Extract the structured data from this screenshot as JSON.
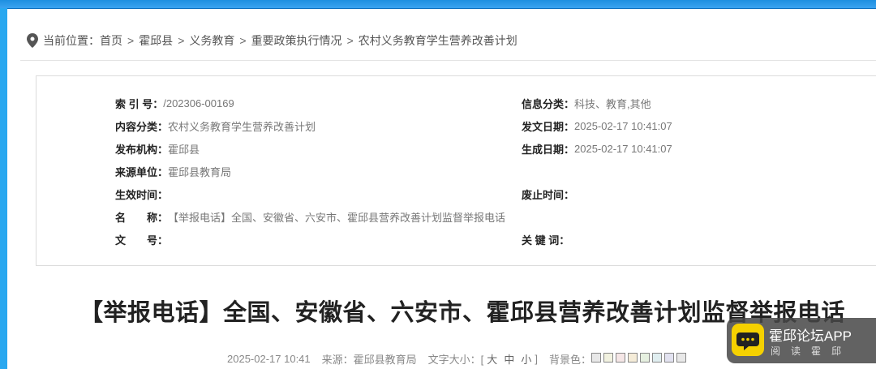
{
  "breadcrumb": {
    "prefix": "当前位置：",
    "items": [
      "首页",
      "霍邱县",
      "义务教育",
      "重要政策执行情况",
      "农村义务教育学生营养改善计划"
    ],
    "separator": ">"
  },
  "info": {
    "index_no": {
      "label": "索 引 号：",
      "value": "/202306-00169"
    },
    "info_category": {
      "label": "信息分类：",
      "value": "科技、教育,其他"
    },
    "content_category": {
      "label": "内容分类：",
      "value": "农村义务教育学生营养改善计划"
    },
    "issue_date": {
      "label": "发文日期：",
      "value": "2025-02-17 10:41:07"
    },
    "publisher": {
      "label": "发布机构：",
      "value": "霍邱县"
    },
    "generated_date": {
      "label": "生成日期：",
      "value": "2025-02-17 10:41:07"
    },
    "source_unit": {
      "label": "来源单位：",
      "value": "霍邱县教育局"
    },
    "effective_time": {
      "label": "生效时间：",
      "value": ""
    },
    "expiry_time": {
      "label": "废止时间：",
      "value": ""
    },
    "name": {
      "label": "名　　称：",
      "value": "【举报电话】全国、安徽省、六安市、霍邱县营养改善计划监督举报电话"
    },
    "doc_no": {
      "label": "文　　号：",
      "value": ""
    },
    "keywords": {
      "label": "关 键 词：",
      "value": ""
    }
  },
  "article": {
    "title": "【举报电话】全国、安徽省、六安市、霍邱县营养改善计划监督举报电话",
    "date": "2025-02-17 10:41",
    "source": "来源：霍邱县教育局",
    "font_size_label": "文字大小：[",
    "font_sizes": [
      "大",
      "中",
      "小"
    ],
    "font_size_close": "]",
    "bg_label": "背景色：",
    "bg_colors": [
      "#e8e8e8",
      "#f2f2e0",
      "#f5e6e6",
      "#f5ecd8",
      "#e6f0e0",
      "#e0eef0",
      "#e2e2f0",
      "#e8e8e8"
    ]
  },
  "app_badge": {
    "name": "霍邱论坛APP",
    "tagline": "阅读霍邱",
    "icon": "chat-bubble-icon",
    "accent": "#f5d100"
  },
  "colors": {
    "top_bar": "#1e8fe0",
    "left_bar": "#29a8f0"
  }
}
